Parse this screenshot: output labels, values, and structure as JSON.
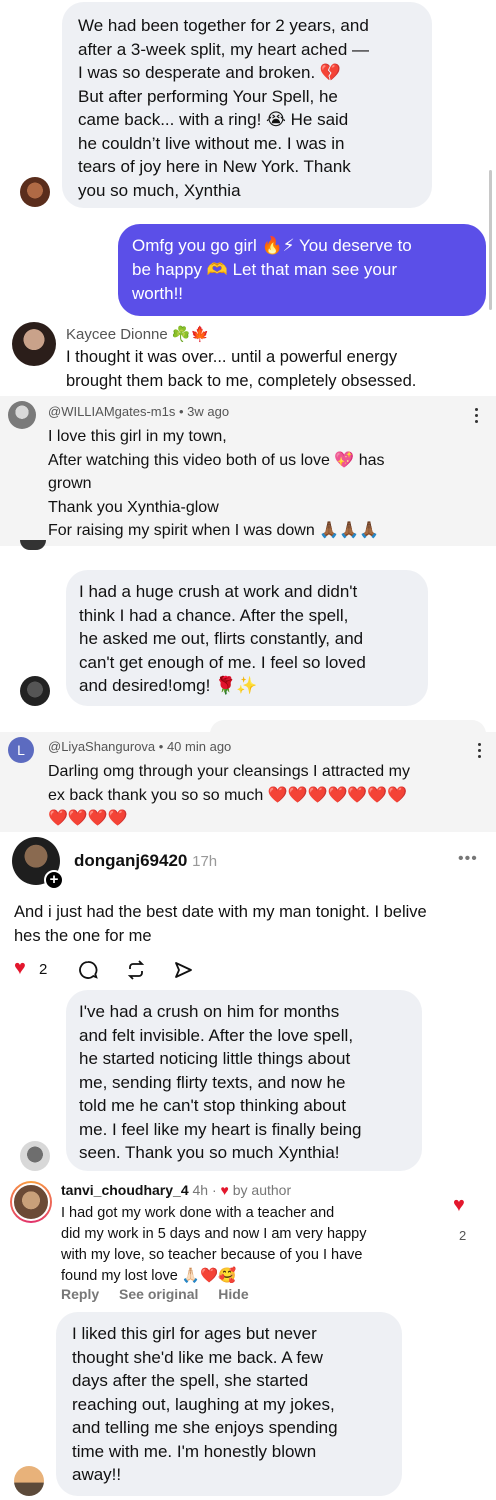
{
  "msg1": {
    "text": "We had been together for 2 years, and\nafter a 3-week split, my heart ached —\nI was so desperate and broken. 💔\nBut after performing Your Spell, he\ncame back... with a ring! 😭 He said\nhe couldn’t live without me. I was in\ntears of joy here in New York. Thank\nyou so much, Xynthia"
  },
  "reply1": {
    "text": "Omfg you go girl 🔥⚡ You deserve to\nbe happy 🫶 Let that man see your\nworth!!",
    "color": "#5b4fe8"
  },
  "kaycee": {
    "name": "Kaycee Dionne ☘️🍁",
    "text": "I thought it was over... until a powerful energy\nbrought them back to me, completely obsessed."
  },
  "william": {
    "handle": "@WILLIAMgates-m1s",
    "time": "3w ago",
    "text": "I love this girl in my town,\nAfter watching this video both of us love 💖 has\ngrown\nThank you Xynthia-glow\nFor raising my spirit when I was down 🙏🏾🙏🏾🙏🏾"
  },
  "msg2": {
    "text": "I had a huge crush at work and didn't\nthink I had a chance. After the spell,\nhe asked me out, flirts constantly, and\ncan't get enough of me. I feel so loved\nand desired!omg! 🌹✨"
  },
  "liya": {
    "initial": "L",
    "handle": "@LiyaShangurova",
    "time": "40 min ago",
    "text": "Darling omg through your cleansings I attracted my\nex back thank you so so much ❤️❤️❤️❤️❤️❤️❤️\n❤️❤️❤️❤️",
    "avatar_color": "#5c6bc0"
  },
  "dongan": {
    "username": "donganj69420",
    "time": "17h",
    "text": "And i just had the best date with my man tonight. I belive\nhes the one for me",
    "likes": "2"
  },
  "msg3": {
    "text": "I've had a crush on him for months\nand felt invisible. After the love spell,\nhe started noticing little things about\nme, sending flirty texts, and now he\ntold me he can't stop thinking about\nme. I feel like my heart is finally being\nseen. Thank you so much Xynthia!"
  },
  "tanvi": {
    "username": "tanvi_choudhary_4",
    "time": "4h",
    "by_author": "by author",
    "text": "I had got my work done with a teacher and\ndid my work in 5 days and now I am very happy\nwith my love, so teacher because of you I have\nfound my lost love 🙏🏻❤️🥰",
    "likes": "2",
    "reply": "Reply",
    "see_original": "See original",
    "hide": "Hide"
  },
  "msg4": {
    "text": "I liked this girl for ages but never\nthought she'd like me back. A few\ndays after the spell, she started\nreaching out, laughing at my jokes,\nand telling me she enjoys spending\ntime with me. I'm honestly blown\naway!!"
  }
}
